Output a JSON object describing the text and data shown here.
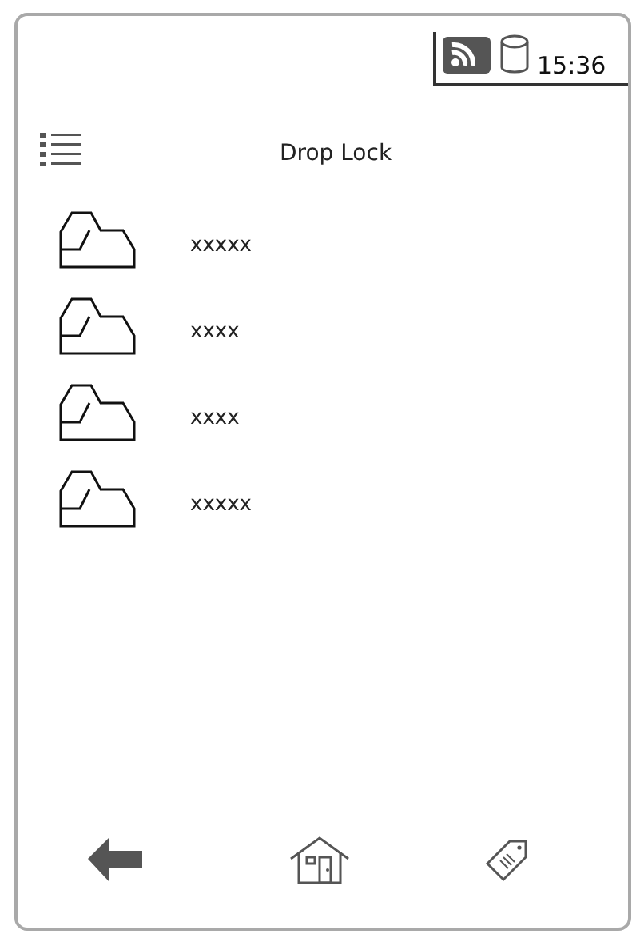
{
  "status_bar": {
    "time": "15:36"
  },
  "header": {
    "title": "Drop Lock"
  },
  "items": [
    {
      "label": "xxxxx"
    },
    {
      "label": "xxxx"
    },
    {
      "label": "xxxx"
    },
    {
      "label": "xxxxx"
    }
  ]
}
